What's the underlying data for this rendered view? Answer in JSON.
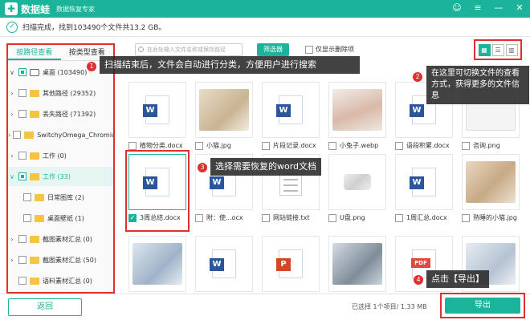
{
  "app": {
    "logo_char": "✚",
    "name": "数据蛙",
    "subtitle": "数据恢复专家"
  },
  "window_controls": [
    "☺",
    "≡",
    "—",
    "✕"
  ],
  "status": {
    "text": "扫描完成，找到103490个文件共13.2 GB。"
  },
  "sidebar": {
    "tabs": [
      "按路径查看",
      "按类型查看"
    ],
    "tree": [
      {
        "label": "桌面 (103490)",
        "chevron": "∨",
        "icon": "drive"
      },
      {
        "label": "其他路径 (29352)",
        "chevron": "›",
        "icon": "folder"
      },
      {
        "label": "丢失路径 (71392)",
        "chevron": "›",
        "icon": "folder"
      },
      {
        "label": "SwitchyOmega_Chromiur",
        "chevron": "›",
        "icon": "folder"
      },
      {
        "label": "工作 (0)",
        "chevron": "›",
        "icon": "folder"
      },
      {
        "label": "工作 (33)",
        "chevron": "∨",
        "icon": "folder"
      },
      {
        "label": "日常图库 (2)",
        "chevron": "",
        "icon": "folder"
      },
      {
        "label": "桌面壁纸 (1)",
        "chevron": "",
        "icon": "folder"
      },
      {
        "label": "截图素材汇总 (0)",
        "chevron": "›",
        "icon": "folder"
      },
      {
        "label": "截图素材汇总 (50)",
        "chevron": "›",
        "icon": "folder"
      },
      {
        "label": "语料素材汇总 (0)",
        "chevron": "",
        "icon": "folder"
      }
    ]
  },
  "toolbar": {
    "search_placeholder": "在此处输入文件名称或保存路径",
    "filter_label": "筛选器",
    "only_deleted_label": "仅显示删除项"
  },
  "view_buttons": [
    "▦",
    "☰",
    "▥"
  ],
  "files": {
    "row1": [
      {
        "name": "植物分类.docx",
        "type": "word"
      },
      {
        "name": "小猫.jpg",
        "type": "image"
      },
      {
        "name": "片段记录.docx",
        "type": "word"
      },
      {
        "name": "小兔子.webp",
        "type": "image"
      },
      {
        "name": "语段积累.docx",
        "type": "word"
      },
      {
        "name": "咨询.png",
        "type": "image"
      }
    ],
    "row2": [
      {
        "name": "3周总结.docx",
        "type": "word"
      },
      {
        "name": "附：使...ocx",
        "type": "word"
      },
      {
        "name": "网站链接.txt",
        "type": "txt"
      },
      {
        "name": "U盘.png",
        "type": "image"
      },
      {
        "name": "1周汇总.docx",
        "type": "word"
      },
      {
        "name": "熟睡的小猫.jpg",
        "type": "image"
      }
    ],
    "row3": [
      {
        "name": "",
        "type": "image"
      },
      {
        "name": "",
        "type": "word"
      },
      {
        "name": "",
        "type": "ppt"
      },
      {
        "name": "",
        "type": "image"
      },
      {
        "name": "",
        "type": "pdf"
      },
      {
        "name": "",
        "type": "image"
      }
    ]
  },
  "annotations": {
    "badge1": "1",
    "tip1": "扫描结束后，文件会自动进行分类，方便用户进行搜索",
    "badge2": "2",
    "tip2": "在这里可切换文件的查看方式，获得更多的文件信息",
    "badge3": "3",
    "tip3": "选择需要恢复的word文档",
    "badge4": "4",
    "tip4": "点击【导出】"
  },
  "footer": {
    "back_label": "返回",
    "selection_info": "已选择 1个项目/ 1.33 MB",
    "export_label": "导出"
  },
  "colors": {
    "accent": "#1bb49a",
    "highlight": "#e02f2f",
    "word": "#2b579a"
  }
}
